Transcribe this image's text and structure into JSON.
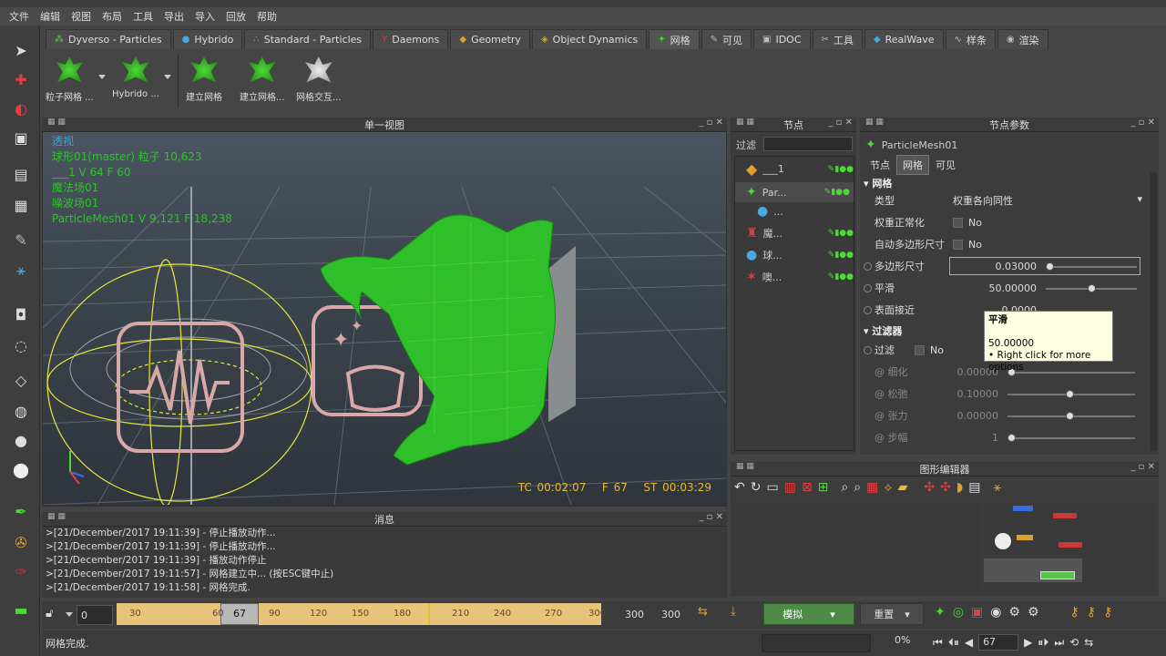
{
  "menu": [
    "文件",
    "编辑",
    "视图",
    "布局",
    "工具",
    "导出",
    "导入",
    "回放",
    "帮助"
  ],
  "tabs": [
    {
      "label": "Dyverso - Particles",
      "icon": "particles-icon"
    },
    {
      "label": "Hybrido",
      "icon": "hybrido-icon"
    },
    {
      "label": "Standard - Particles",
      "icon": "dots-icon"
    },
    {
      "label": "Daemons",
      "icon": "daemon-icon"
    },
    {
      "label": "Geometry",
      "icon": "cube-icon"
    },
    {
      "label": "Object Dynamics",
      "icon": "dynamics-icon"
    },
    {
      "label": "网格",
      "icon": "mesh-icon"
    },
    {
      "label": "可见",
      "icon": "visible-icon"
    },
    {
      "label": "IDOC",
      "icon": "idoc-icon"
    },
    {
      "label": "工具",
      "icon": "tools-icon"
    },
    {
      "label": "RealWave",
      "icon": "wave-icon"
    },
    {
      "label": "样条",
      "icon": "spline-icon"
    },
    {
      "label": "渲染",
      "icon": "render-icon"
    }
  ],
  "shelf": [
    "粒子网格 ...",
    "Hybrido ...",
    "建立网格",
    "建立网格...",
    "网格交互..."
  ],
  "viewport": {
    "title": "单一视图",
    "hud": [
      "透视",
      "球形01(master) 粒子 10,623",
      "___1 V 64 F 60",
      "魔法场01",
      "噪波场01",
      "ParticleMesh01 V 9,121 F 18,238"
    ],
    "tc": "TC 00:02:07",
    "f": "F 67",
    "st": "ST 00:03:29"
  },
  "messages": {
    "title": "消息",
    "lines": [
      ">[21/December/2017 19:11:39] - 停止播放动作...",
      ">[21/December/2017 19:11:39] - 停止播放动作...",
      ">[21/December/2017 19:11:39] - 播放动作停止",
      ">[21/December/2017 19:11:57] - 网格建立中... (按ESC键中止)",
      ">[21/December/2017 19:11:58] - 网格完成."
    ]
  },
  "nodes": {
    "title": "节点",
    "filter": "过滤",
    "items": [
      "___1",
      "Par...",
      "...",
      "魔...",
      "球...",
      "噢..."
    ]
  },
  "params": {
    "title": "节点参数",
    "node": "ParticleMesh01",
    "tabs": [
      "节点",
      "网格",
      "可见"
    ],
    "section1": "网格",
    "rows": [
      {
        "label": "类型",
        "value": "权重各向同性"
      },
      {
        "label": "权重正常化",
        "value": "No"
      },
      {
        "label": "自动多边形尺寸",
        "value": "No"
      },
      {
        "label": "多边形尺寸",
        "value": "0.03000"
      },
      {
        "label": "平滑",
        "value": "50.00000"
      },
      {
        "label": "表面接近",
        "value": "0.0000"
      }
    ],
    "section2": "过滤器",
    "filters": [
      {
        "label": "过滤",
        "value": "No"
      },
      {
        "label": "@ 细化",
        "value": "0.00000"
      },
      {
        "label": "@ 松弛",
        "value": "0.10000"
      },
      {
        "label": "@ 张力",
        "value": "0.00000"
      },
      {
        "label": "@ 步幅",
        "value": "1"
      }
    ]
  },
  "tooltip": {
    "title": "平滑",
    "value": "50.00000",
    "hint": "• Right click for more options"
  },
  "graph": {
    "title": "图形编辑器"
  },
  "timeline": {
    "start": "0",
    "ticks": [
      "30",
      "60",
      "90",
      "120",
      "150",
      "180",
      "210",
      "240",
      "270",
      "300"
    ],
    "current": "67",
    "end1": "300",
    "end2": "300",
    "simulate": "模拟",
    "reset": "重置",
    "frame": "67",
    "percent": "0%"
  },
  "status": "网格完成."
}
